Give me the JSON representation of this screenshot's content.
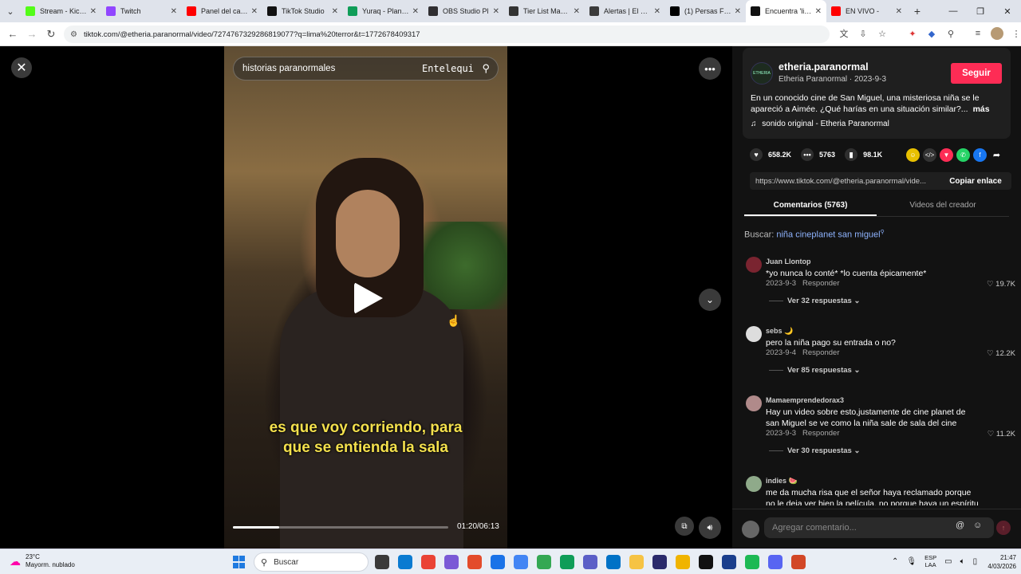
{
  "browser": {
    "tabs": [
      {
        "label": "Stream - Kick C",
        "color": "#53fc18"
      },
      {
        "label": "Twitch",
        "color": "#9146ff"
      },
      {
        "label": "Panel del canal",
        "color": "#ff0000"
      },
      {
        "label": "TikTok Studio",
        "color": "#111111"
      },
      {
        "label": "Yuraq - Planific",
        "color": "#0f9d58"
      },
      {
        "label": "OBS Studio Pl",
        "color": "#302e31"
      },
      {
        "label": "Tier List Maker",
        "color": "#333333"
      },
      {
        "label": "Alertas | El mej",
        "color": "#3b3b3b"
      },
      {
        "label": "(1) Persas FC (@",
        "color": "#000000"
      },
      {
        "label": "Encuentra 'lima",
        "color": "#111111"
      },
      {
        "label": "EN VIVO -",
        "color": "#ff0000"
      }
    ],
    "url": "tiktok.com/@etheria.paranormal/video/7274767329286819077?q=lima%20terror&t=1772678409317"
  },
  "video": {
    "search_text": "historias paranormales",
    "watermark": "Entelequi",
    "subtitle_line1": "es que voy corriendo, para",
    "subtitle_line2": "que se entienda la sala",
    "timecode": "01:20/06:13",
    "progress": 0.215
  },
  "creator": {
    "username": "etheria.paranormal",
    "avatar_text": "ETHERIA",
    "subline": "Etheria Paranormal · 2023-9-3",
    "follow_label": "Seguir",
    "description": "En un conocido cine de San Miguel, una misteriosa niña se le apareció a Aimée. ¿Qué harías en una situación similar?...",
    "more_label": "más",
    "music": "sonido original - Etheria Paranormal"
  },
  "stats": {
    "likes": "658.2K",
    "comments": "5763",
    "saves": "98.1K"
  },
  "link": {
    "url": "https://www.tiktok.com/@etheria.paranormal/vide...",
    "copy_label": "Copiar enlace"
  },
  "panel_tabs": {
    "comments": "Comentarios (5763)",
    "creator_videos": "Videos del creador"
  },
  "search": {
    "prefix": "Buscar:",
    "query": "niña cineplanet san miguel"
  },
  "comments": [
    {
      "user": "Juan Llontop",
      "text": "*yo nunca lo conté* *lo cuenta épicamente*",
      "date": "2023-9-3",
      "reply": "Responder",
      "likes": "19.7K",
      "replies": "Ver 32 respuestas",
      "avatar": "#7a2430"
    },
    {
      "user": "sebs 🌙",
      "text": "pero la niña pago su entrada o no?",
      "date": "2023-9-4",
      "reply": "Responder",
      "likes": "12.2K",
      "replies": "Ver 85 respuestas",
      "avatar": "#dddddd"
    },
    {
      "user": "Mamaemprendedorax3",
      "text": "Hay un video sobre esto,justamente de cine planet de san Miguel se ve como la niña sale de sala del cine",
      "date": "2023-9-3",
      "reply": "Responder",
      "likes": "11.2K",
      "replies": "Ver 30 respuestas",
      "avatar": "#b08a8a"
    },
    {
      "user": "indies 🍉",
      "text": "me da mucha risa que el señor haya reclamado porque no le deja ver bien la película, no porque haya un espíritu de",
      "date": "",
      "reply": "",
      "likes": "",
      "replies": "",
      "avatar": "#8faa8a"
    }
  ],
  "comment_input": {
    "placeholder": "Agregar comentario..."
  },
  "taskbar": {
    "temp": "23°C",
    "weather": "Mayorm. nublado",
    "search": "Buscar",
    "lang1": "ESP",
    "lang2": "LAA",
    "time": "21:47",
    "date": "4/03/2026",
    "apps": [
      "#3a3a3a",
      "#0a7bd1",
      "#ea4335",
      "#7a59d6",
      "#e34b2b",
      "#1a73e8",
      "#4285f4",
      "#34a853",
      "#0f9d58",
      "#5b5fc7",
      "#0072c6",
      "#f6c343",
      "#2a2a6b",
      "#f0b400",
      "#111111",
      "#1a3e8c",
      "#1db954",
      "#5865f2",
      "#d24726"
    ]
  }
}
